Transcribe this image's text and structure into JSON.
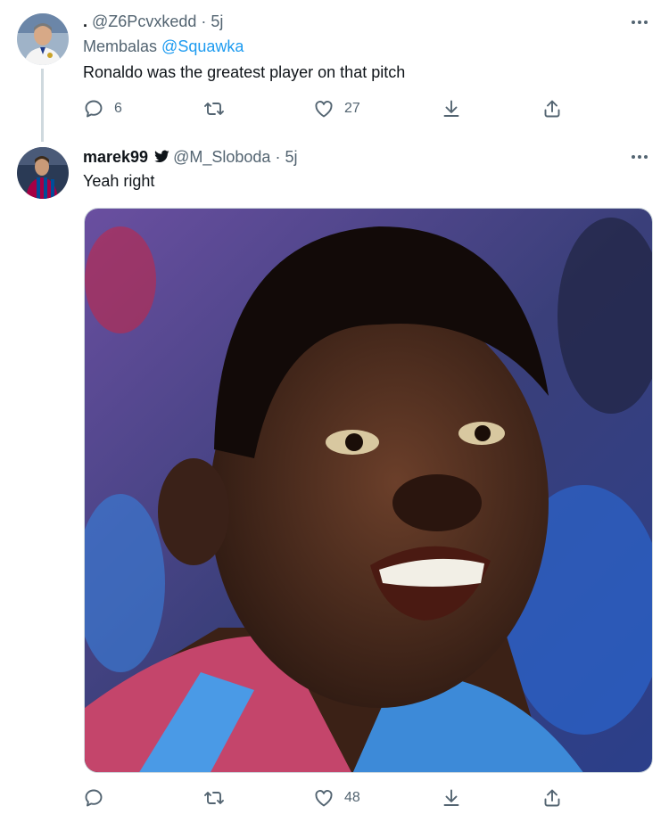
{
  "tweet1": {
    "display_name": ".",
    "handle": "@Z6Pcvxkedd",
    "time": "5j",
    "replying_prefix": "Membalas",
    "replying_to": "@Squawka",
    "text": "Ronaldo was the greatest player on that pitch",
    "replies": "6",
    "retweets": "",
    "likes": "27"
  },
  "tweet2": {
    "display_name": "marek99",
    "handle": "@M_Sloboda",
    "time": "5j",
    "text": "Yeah right",
    "replies": "",
    "retweets": "",
    "likes": "48"
  },
  "separator": "·",
  "colors": {
    "link": "#1d9bf0",
    "secondary_text": "#536471",
    "primary_text": "#0f1419",
    "divider": "#cfd9de"
  },
  "icons": [
    "more-icon",
    "reply-icon",
    "retweet-icon",
    "like-icon",
    "download-icon",
    "share-icon",
    "verified-icon"
  ]
}
